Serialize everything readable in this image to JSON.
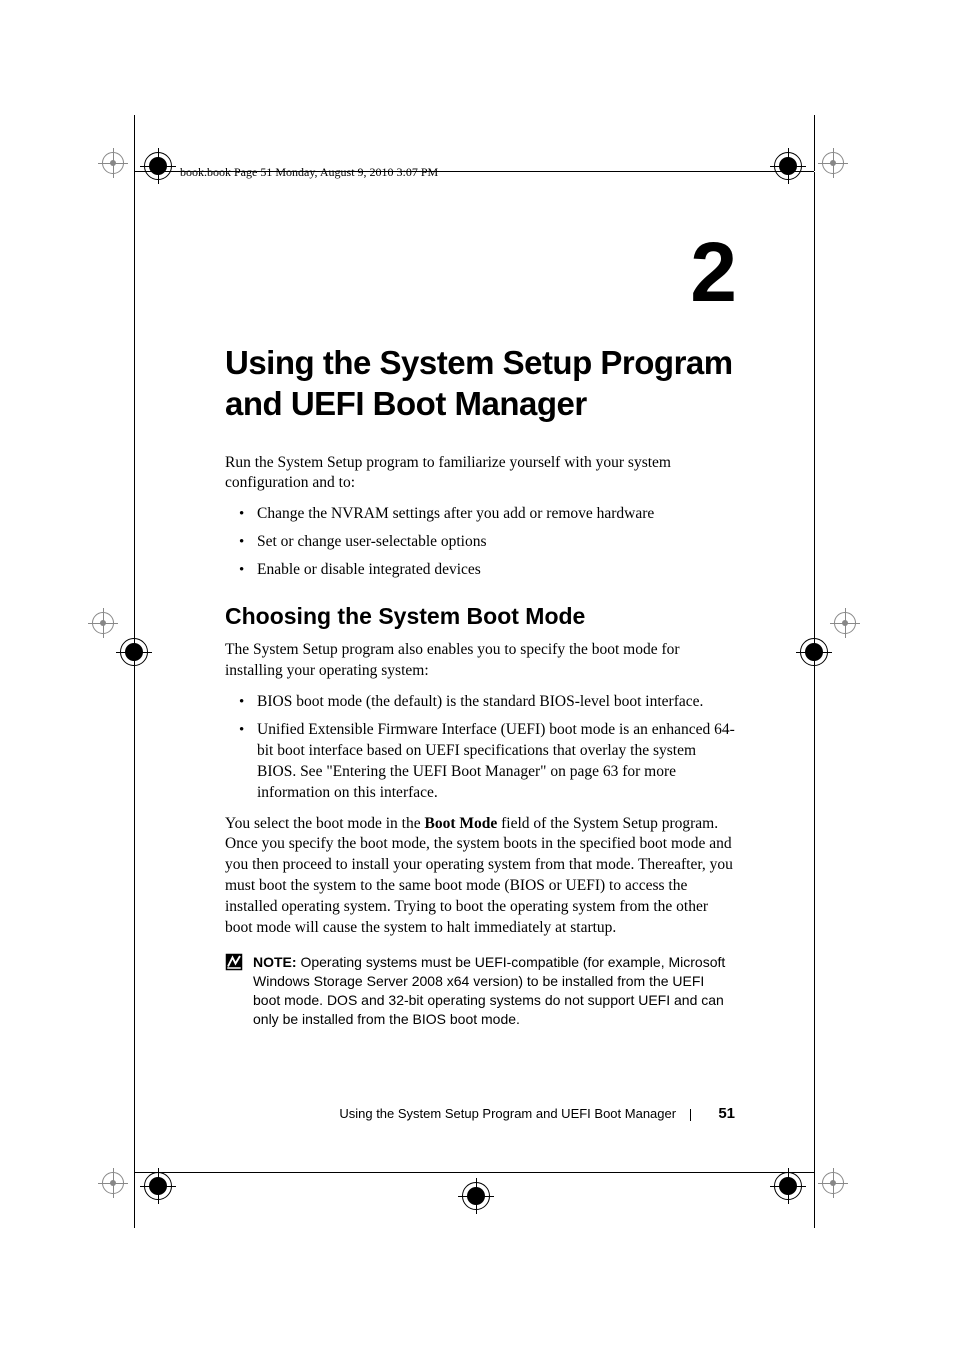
{
  "header_printline": "book.book  Page 51  Monday, August 9, 2010  3:07 PM",
  "chapter_number": "2",
  "title": "Using the System Setup Program and UEFI Boot Manager",
  "intro": "Run the System Setup program to familiarize yourself with your system configuration and to:",
  "intro_bullets": [
    "Change the NVRAM settings after you add or remove hardware",
    "Set or change user-selectable options",
    "Enable or disable integrated devices"
  ],
  "section_heading": "Choosing the System Boot Mode",
  "section_intro": "The System Setup program also enables you to specify the boot mode for installing your operating system:",
  "section_bullets": [
    "BIOS boot mode (the default) is the standard BIOS-level boot interface.",
    "Unified Extensible Firmware Interface (UEFI) boot mode is an enhanced 64-bit boot interface based on UEFI specifications that overlay the system BIOS. See \"Entering the UEFI Boot Manager\" on page 63 for more information on this interface."
  ],
  "boot_para_pre": "You select the boot mode in the ",
  "boot_para_bold": "Boot Mode",
  "boot_para_post": " field of the System Setup program. Once you specify the boot mode, the system boots in the specified boot mode and you then proceed to install your operating system from that mode. Thereafter, you must boot the system to the same boot mode (BIOS or UEFI) to access the installed operating system. Trying to boot the operating system from the other boot mode will cause the system to halt immediately at startup.",
  "note_label": "NOTE:",
  "note_text": " Operating systems must be UEFI-compatible (for example, Microsoft Windows Storage Server 2008 x64 version) to be installed from the UEFI boot mode. DOS and 32-bit operating systems do not support UEFI and can only be installed from the BIOS boot mode.",
  "footer_text": "Using the System Setup Program and UEFI Boot Manager",
  "page_number": "51"
}
